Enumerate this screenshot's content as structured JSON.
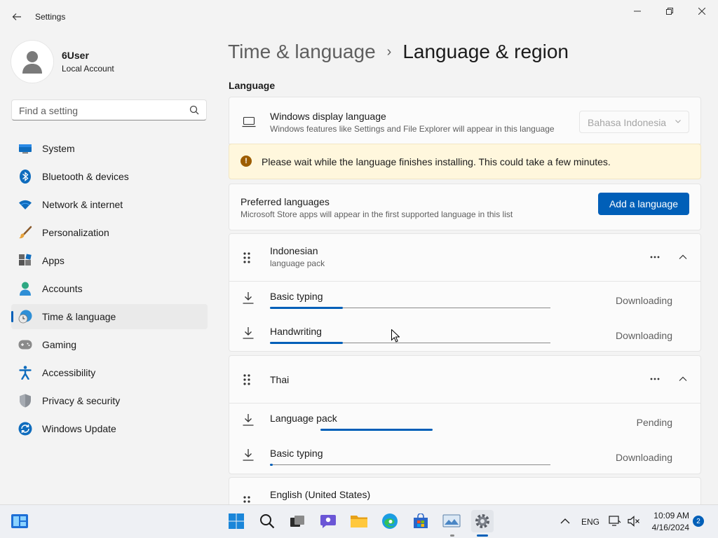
{
  "window": {
    "title": "Settings",
    "controls": [
      "minimize",
      "maximize",
      "close"
    ]
  },
  "profile": {
    "name": "6User",
    "account_type": "Local Account"
  },
  "search": {
    "placeholder": "Find a setting"
  },
  "sidebar": {
    "items": [
      {
        "label": "System",
        "icon": "system-icon"
      },
      {
        "label": "Bluetooth & devices",
        "icon": "bluetooth-icon"
      },
      {
        "label": "Network & internet",
        "icon": "wifi-icon"
      },
      {
        "label": "Personalization",
        "icon": "brush-icon"
      },
      {
        "label": "Apps",
        "icon": "apps-icon"
      },
      {
        "label": "Accounts",
        "icon": "accounts-icon"
      },
      {
        "label": "Time & language",
        "icon": "time-language-icon",
        "active": true
      },
      {
        "label": "Gaming",
        "icon": "gamepad-icon"
      },
      {
        "label": "Accessibility",
        "icon": "accessibility-icon"
      },
      {
        "label": "Privacy & security",
        "icon": "shield-icon"
      },
      {
        "label": "Windows Update",
        "icon": "update-icon"
      }
    ]
  },
  "breadcrumb": {
    "parent": "Time & language",
    "separator": "›",
    "current": "Language & region"
  },
  "language_section": {
    "title": "Language",
    "display_language": {
      "title": "Windows display language",
      "subtitle": "Windows features like Settings and File Explorer will appear in this language",
      "selected": "Bahasa Indonesia"
    },
    "warning": "Please wait while the language finishes installing. This could take a few minutes.",
    "preferred": {
      "title": "Preferred languages",
      "subtitle": "Microsoft Store apps will appear in the first supported language in this list",
      "button": "Add a language"
    },
    "languages": [
      {
        "name": "Indonesian",
        "subtitle": "language pack",
        "features": [
          {
            "name": "Basic typing",
            "status": "Downloading",
            "progress": 0.26
          },
          {
            "name": "Handwriting",
            "status": "Downloading",
            "progress": 0.26
          }
        ]
      },
      {
        "name": "Thai",
        "subtitle": "",
        "features": [
          {
            "name": "Language pack",
            "status": "Pending",
            "progress": 0.4
          },
          {
            "name": "Basic typing",
            "status": "Downloading",
            "progress": 0.01
          }
        ]
      },
      {
        "name": "English (United States)",
        "subtitle": ""
      }
    ]
  },
  "taskbar": {
    "language": "ENG",
    "time": "10:09 AM",
    "date": "4/16/2024",
    "notification_count": "2",
    "apps": [
      "start-icon",
      "search-icon",
      "task-view-icon",
      "chat-icon",
      "file-explorer-icon",
      "edge-icon",
      "store-icon",
      "photos-icon",
      "settings-icon"
    ]
  },
  "colors": {
    "accent": "#005fb8",
    "warning_bg": "#fff7dd",
    "warning_icon": "#9d5d00"
  }
}
